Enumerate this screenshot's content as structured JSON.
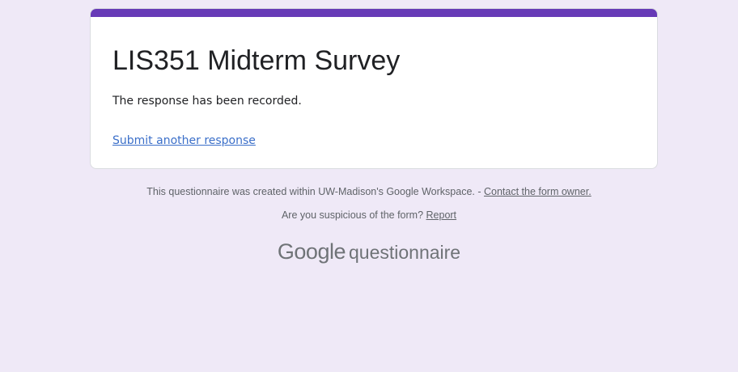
{
  "colors": {
    "background": "#efe9f7",
    "accent": "#673ab7",
    "link": "#3b6fc9",
    "muted_text": "#5f6368"
  },
  "form": {
    "title": "LIS351 Midterm Survey",
    "confirmation_message": "The response has been recorded.",
    "submit_another_label": "Submit another response"
  },
  "footer": {
    "created_text": "This questionnaire was created within UW-Madison's Google Workspace. - ",
    "contact_owner_label": "Contact the form owner.",
    "suspicious_text": "Are you suspicious of the form? ",
    "report_label": "Report"
  },
  "brand": {
    "google": "Google",
    "product": "questionnaire"
  }
}
